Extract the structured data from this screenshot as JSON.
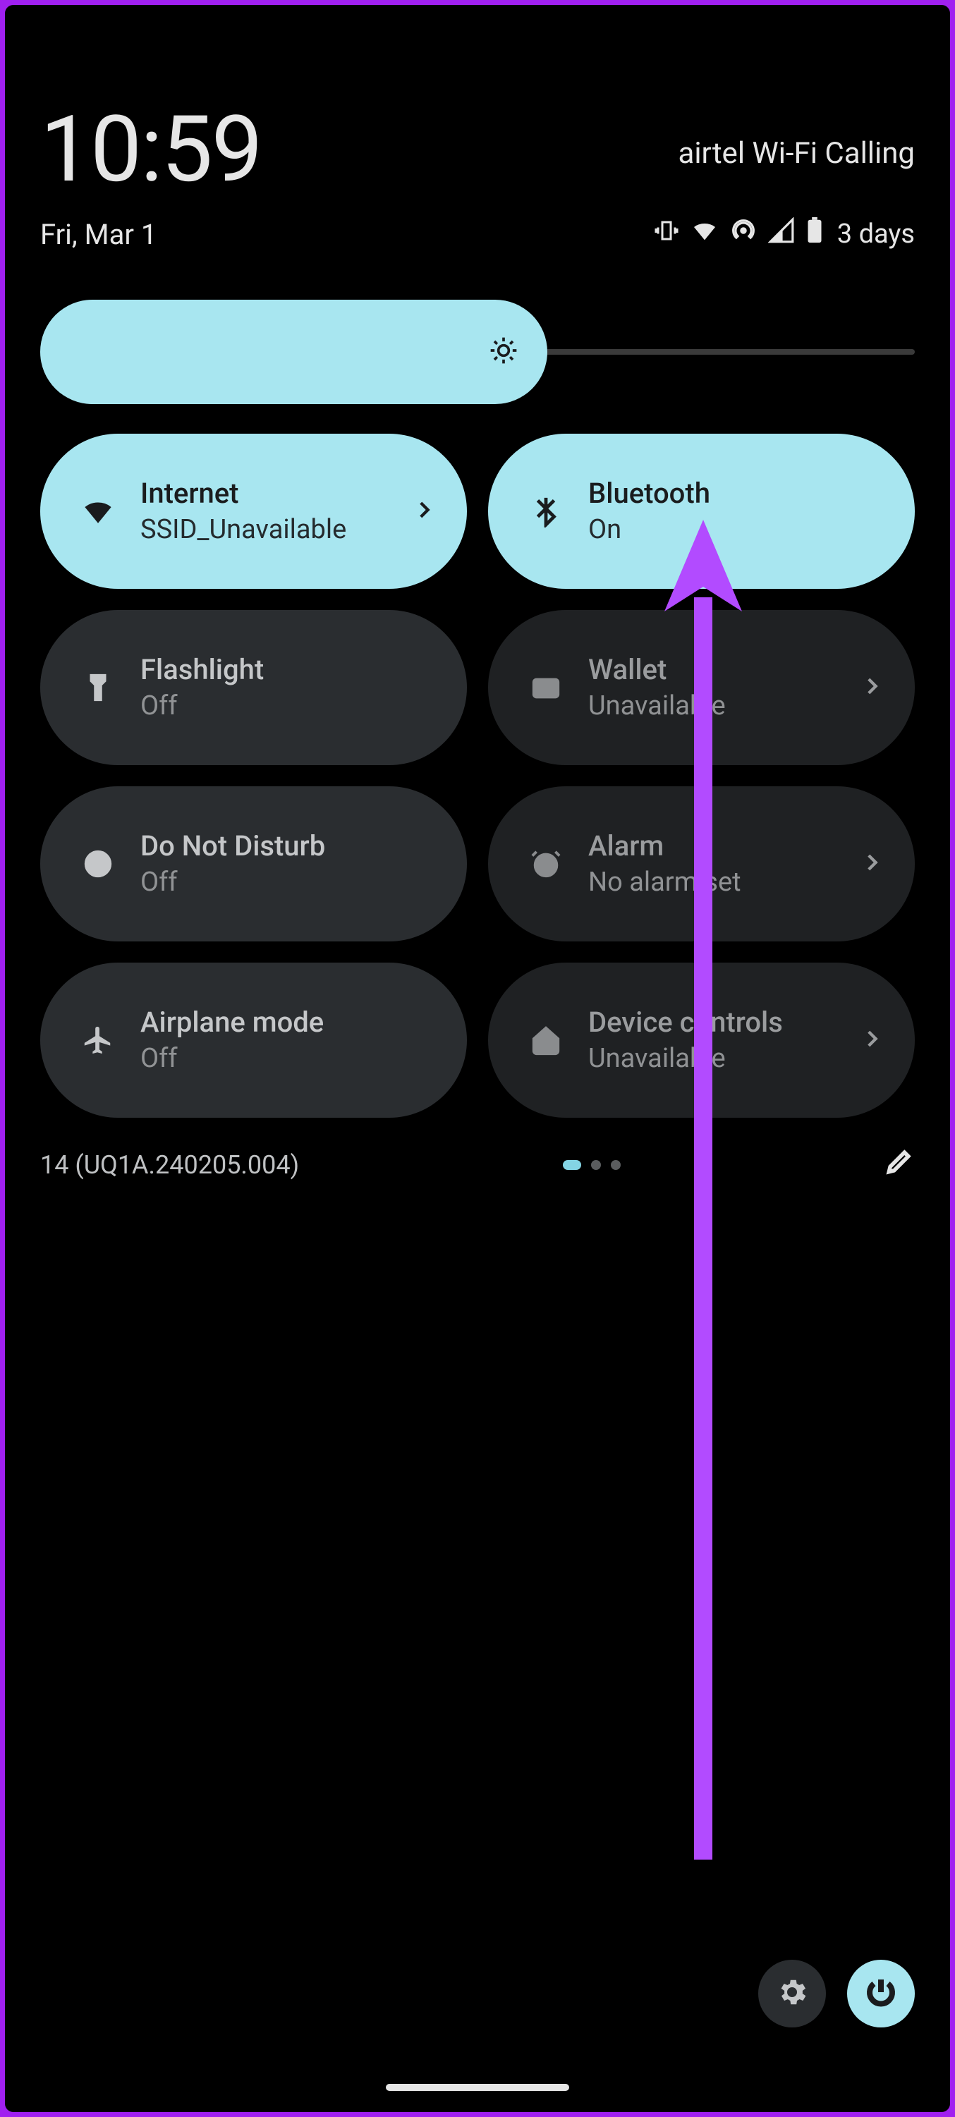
{
  "accent_on": "#a8e6f0",
  "tile_off_bg": "#2a2d30",
  "header": {
    "time": "10:59",
    "carrier": "airtel Wi-Fi Calling",
    "date": "Fri, Mar 1",
    "battery_text": "3 days"
  },
  "brightness": {
    "percent": 58
  },
  "tiles": [
    {
      "id": "internet",
      "title": "Internet",
      "sub": "SSID_Unavailable",
      "on": true,
      "chevron": true
    },
    {
      "id": "bluetooth",
      "title": "Bluetooth",
      "sub": "On",
      "on": true,
      "chevron": false
    },
    {
      "id": "flashlight",
      "title": "Flashlight",
      "sub": "Off",
      "on": false,
      "chevron": false
    },
    {
      "id": "wallet",
      "title": "Wallet",
      "sub": "Unavailable",
      "on": false,
      "chevron": true,
      "dim": true
    },
    {
      "id": "dnd",
      "title": "Do Not Disturb",
      "sub": "Off",
      "on": false,
      "chevron": false
    },
    {
      "id": "alarm",
      "title": "Alarm",
      "sub": "No alarm set",
      "on": false,
      "chevron": true,
      "dim": true
    },
    {
      "id": "airplane",
      "title": "Airplane mode",
      "sub": "Off",
      "on": false,
      "chevron": false
    },
    {
      "id": "device-controls",
      "title": "Device controls",
      "sub": "Unavailable",
      "on": false,
      "chevron": true,
      "dim": true
    }
  ],
  "build": "14 (UQ1A.240205.004)",
  "pages": {
    "count": 3,
    "active": 0
  },
  "annotation": {
    "arrow_color": "#b24bff"
  }
}
